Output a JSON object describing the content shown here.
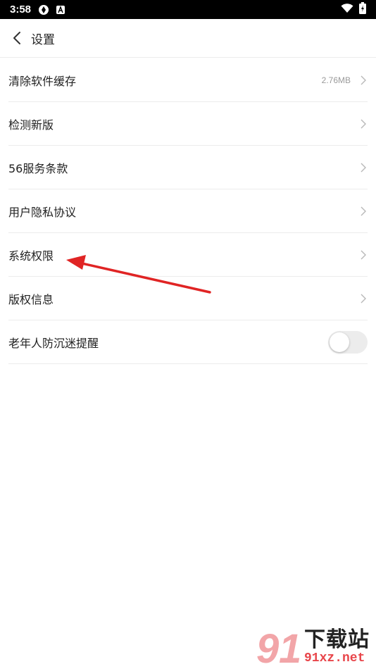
{
  "status_bar": {
    "time": "3:58"
  },
  "header": {
    "title": "设置"
  },
  "settings": {
    "items": [
      {
        "label": "清除软件缓存",
        "value": "2.76MB"
      },
      {
        "label": "检测新版"
      },
      {
        "label": "56服务条款"
      },
      {
        "label": "用户隐私协议"
      },
      {
        "label": "系统权限"
      },
      {
        "label": "版权信息"
      },
      {
        "label": "老年人防沉迷提醒",
        "toggle_on": false
      }
    ]
  },
  "watermark": {
    "title": "下载站",
    "url": "91xz.net"
  },
  "colors": {
    "annotation_arrow": "#e02424",
    "divider": "#ececec",
    "secondary_text": "#9a9a9a"
  }
}
